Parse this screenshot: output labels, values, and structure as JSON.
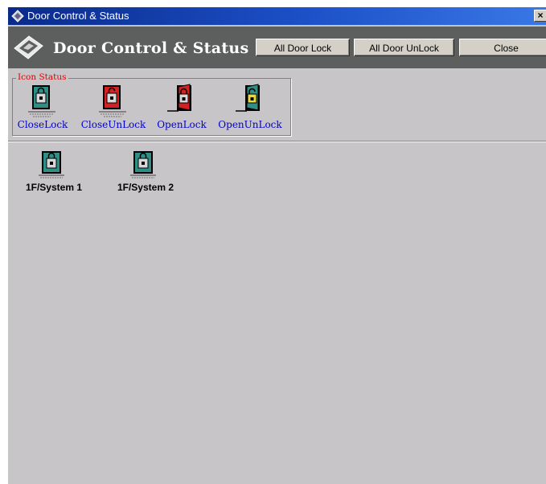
{
  "window": {
    "title": "Door Control & Status",
    "close_glyph": "×"
  },
  "banner": {
    "title": "Door Control & Status",
    "logo_icon": "diamond-logo-icon"
  },
  "toolbar": {
    "all_lock_label": "All Door Lock",
    "all_unlock_label": "All Door UnLock",
    "close_label": "Close"
  },
  "legend": {
    "caption": "Icon Status",
    "items": [
      {
        "label": "CloseLock",
        "icon": "closed-door-locked-icon",
        "door_color": "#2f8f86"
      },
      {
        "label": "CloseUnLock",
        "icon": "closed-door-unlocked-icon",
        "door_color": "#d42020"
      },
      {
        "label": "OpenLock",
        "icon": "open-door-locked-icon",
        "door_color": "#d42020"
      },
      {
        "label": "OpenUnLock",
        "icon": "open-door-unlocked-icon",
        "door_color": "#2f8f86"
      }
    ]
  },
  "doors": [
    {
      "label": "1F/System 1",
      "icon": "closed-door-locked-icon",
      "door_color": "#2f8f86"
    },
    {
      "label": "1F/System 2",
      "icon": "closed-door-locked-icon",
      "door_color": "#2f8f86"
    }
  ],
  "colors": {
    "titlebar": "#0a2a8a",
    "banner": "#5d5f5e",
    "background": "#c8c5c8",
    "legend_label": "#0000d0",
    "legend_caption": "#e00000"
  }
}
